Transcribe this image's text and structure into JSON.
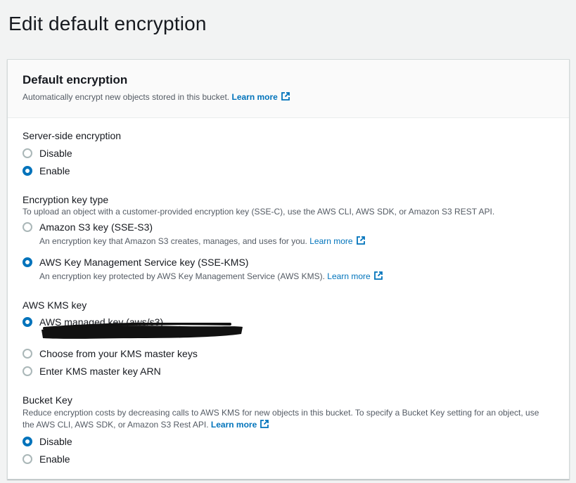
{
  "page": {
    "title": "Edit default encryption"
  },
  "panel": {
    "heading": "Default encryption",
    "description": "Automatically encrypt new objects stored in this bucket.",
    "learn_more": "Learn more"
  },
  "sse": {
    "label": "Server-side encryption",
    "options": [
      {
        "label": "Disable",
        "checked": false
      },
      {
        "label": "Enable",
        "checked": true
      }
    ]
  },
  "key_type": {
    "label": "Encryption key type",
    "description": "To upload an object with a customer-provided encryption key (SSE-C), use the AWS CLI, AWS SDK, or Amazon S3 REST API.",
    "options": [
      {
        "label": "Amazon S3 key (SSE-S3)",
        "description": "An encryption key that Amazon S3 creates, manages, and uses for you.",
        "learn_more": "Learn more",
        "checked": false
      },
      {
        "label": "AWS Key Management Service key (SSE-KMS)",
        "description": "An encryption key protected by AWS Key Management Service (AWS KMS).",
        "learn_more": "Learn more",
        "checked": true
      }
    ]
  },
  "kms_key": {
    "label": "AWS KMS key",
    "options": [
      {
        "label": "AWS managed key (aws/s3)",
        "checked": true
      },
      {
        "label": "Choose from your KMS master keys",
        "checked": false
      },
      {
        "label": "Enter KMS master key ARN",
        "checked": false
      }
    ]
  },
  "bucket_key": {
    "label": "Bucket Key",
    "description_line1": "Reduce encryption costs by decreasing calls to AWS KMS for new objects in this bucket. To specify a Bucket Key setting for an object, use",
    "description_line2": "the AWS CLI, AWS SDK, or Amazon S3 Rest API.",
    "learn_more": "Learn more",
    "options": [
      {
        "label": "Disable",
        "checked": true
      },
      {
        "label": "Enable",
        "checked": false
      }
    ]
  },
  "colors": {
    "accent": "#0073bb",
    "background": "#f2f3f3",
    "text": "#16191f",
    "muted": "#545b64"
  },
  "icons": {
    "external_link": "external-link-icon"
  }
}
